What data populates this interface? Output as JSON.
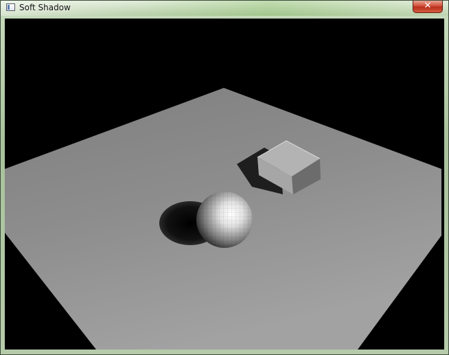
{
  "window": {
    "title": "Soft Shadow",
    "close_glyph": "✕"
  },
  "icons": {
    "app": "app-window-icon",
    "close": "close-icon"
  },
  "scene": {
    "background": "#000000",
    "floor_color": "#8c8c8c",
    "objects": [
      "floor-plane",
      "sphere",
      "cube"
    ]
  }
}
